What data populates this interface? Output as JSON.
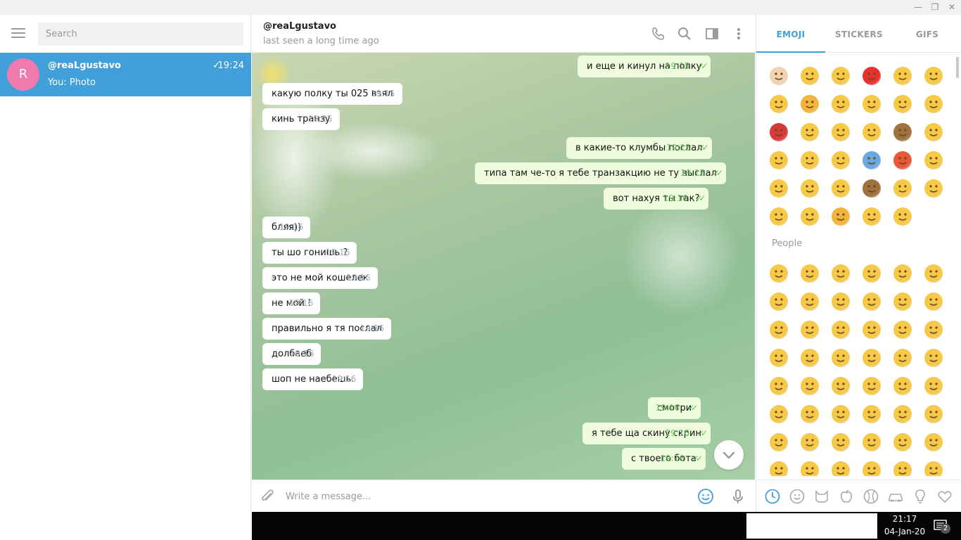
{
  "window": {
    "minimize": "—",
    "restore": "❐",
    "close": "✕"
  },
  "sidebar": {
    "search_placeholder": "Search",
    "chat": {
      "avatar_letter": "R",
      "name": "@reaLgustavo",
      "time": "19:24",
      "check": "✓",
      "preview": "You: Photo"
    }
  },
  "header": {
    "name": "@reaLgustavo",
    "status": "last seen a long time ago"
  },
  "messages": [
    {
      "dir": "out",
      "text": "и еще и кинул на полку",
      "time": "19:15"
    },
    {
      "dir": "in",
      "text": "какую полку ты 025 взял",
      "time": "19:15"
    },
    {
      "dir": "in",
      "text": "кинь транзу",
      "time": "19:15"
    },
    {
      "dir": "out",
      "text": "в какие-то клумбы послал",
      "time": "19:15"
    },
    {
      "dir": "out",
      "text": "типа там че-то я тебе транзакцию не ту выслал",
      "time": "19:15"
    },
    {
      "dir": "out",
      "text": "вот нахуя ты так?",
      "time": "19:16"
    },
    {
      "dir": "in",
      "text": "бляя))",
      "time": "19:16"
    },
    {
      "dir": "in",
      "text": "ты шо гонишь ?",
      "time": "19:16"
    },
    {
      "dir": "in",
      "text": "это не мой кошелек",
      "time": "19:16"
    },
    {
      "dir": "in",
      "text": "не мой !",
      "time": "19:16"
    },
    {
      "dir": "in",
      "text": "правильно я тя послал",
      "time": "19:16"
    },
    {
      "dir": "in",
      "text": "долбаеб",
      "time": "19:16"
    },
    {
      "dir": "in",
      "text": "шоп не наебешь.",
      "time": "19:16"
    },
    {
      "dir": "out",
      "text": "смотри",
      "time": "19:16"
    },
    {
      "dir": "out",
      "text": "я тебе ща скину скрин",
      "time": "19:16"
    },
    {
      "dir": "out",
      "text": "с твоего бота",
      "time": "19:16"
    }
  ],
  "composer": {
    "placeholder": "Write a message..."
  },
  "emoji_panel": {
    "tabs": [
      "EMOJI",
      "STICKERS",
      "GIFS"
    ],
    "active_tab": "EMOJI",
    "section_people": "People",
    "recent_colors": [
      "#f2d1b0",
      "#f7c948",
      "#f7c948",
      "#e8322f",
      "#f7c948",
      "#f7c948",
      "#f7c948",
      "#f2b43c",
      "#f7c948",
      "#f7c948",
      "#f7c948",
      "#f7c948",
      "#d63a3a",
      "#f7c948",
      "#f7c948",
      "#f7c948",
      "#a0703f",
      "#f7c948",
      "#f7c948",
      "#f7c948",
      "#f7c948",
      "#6aa8e0",
      "#e8573a",
      "#f7c948",
      "#f7c948",
      "#f7c948",
      "#f7c948",
      "#a0703f",
      "#f7c948",
      "#f7c948",
      "#f7c948",
      "#f7c948",
      "#f2b43c",
      "#f7c948",
      "#f7c948"
    ],
    "people_colors": [
      "#f7c948",
      "#f7c948",
      "#f7c948",
      "#f7c948",
      "#f7c948",
      "#f7c948",
      "#f7c948",
      "#f7c948",
      "#f7c948",
      "#f7c948",
      "#f7c948",
      "#f7c948",
      "#f7c948",
      "#f7c948",
      "#f7c948",
      "#f7c948",
      "#f7c948",
      "#f7c948",
      "#f7c948",
      "#f7c948",
      "#f7c948",
      "#f7c948",
      "#f7c948",
      "#f7c948",
      "#f7c948",
      "#f7c948",
      "#f7c948",
      "#f7c948",
      "#f7c948",
      "#f7c948",
      "#f7c948",
      "#f7c948",
      "#f7c948",
      "#f7c948",
      "#f7c948",
      "#f7c948",
      "#f7c948",
      "#f7c948",
      "#f7c948",
      "#f7c948",
      "#f7c948",
      "#f7c948",
      "#f7c948",
      "#f7c948",
      "#f7c948",
      "#f7c948",
      "#f7c948",
      "#f7c948"
    ]
  },
  "taskbar": {
    "time": "21:17",
    "date": "04-Jan-20",
    "notif_count": "2"
  },
  "colors": {
    "accent": "#419fd9",
    "avatar": "#ee7aae",
    "outgoing": "#effdde",
    "check": "#5dc452"
  }
}
